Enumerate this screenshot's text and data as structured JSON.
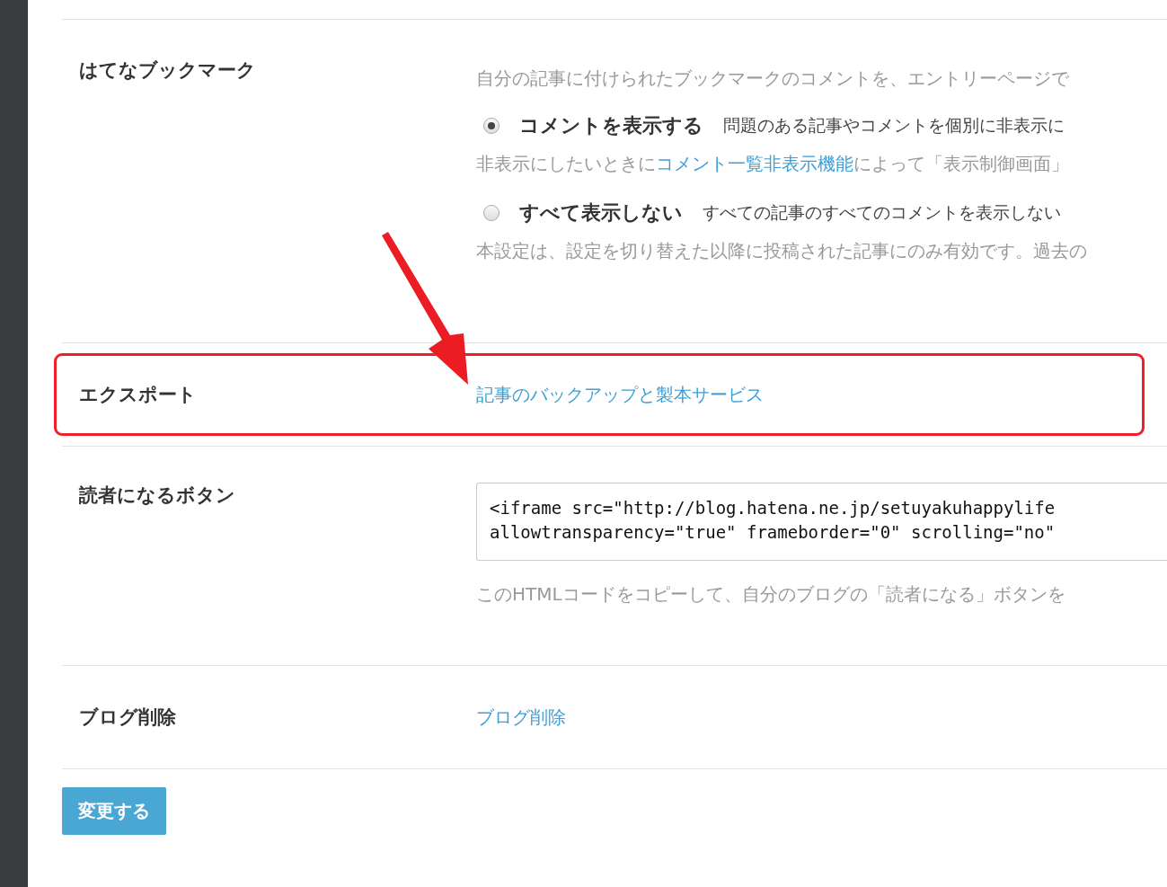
{
  "sections": [
    {
      "kind": "radio_group",
      "label": "はてなブックマーク",
      "description": "自分の記事に付けられたブックマークのコメントを、エントリーページで",
      "options": [
        {
          "label": "コメントを表示する",
          "description": "問題のある記事やコメントを個別に非表示に",
          "selected": true,
          "note_before": "非表示にしたいときに",
          "note_link": "コメント一覧非表示機能",
          "note_after": "によって「表示制御画面」"
        },
        {
          "label": "すべて表示しない",
          "description": "すべての記事のすべてのコメントを表示しない",
          "selected": false
        }
      ],
      "footnote": "本設定は、設定を切り替えた以降に投稿された記事にのみ有効です。過去の"
    },
    {
      "kind": "link",
      "label": "エクスポート",
      "link": "記事のバックアップと製本サービス"
    },
    {
      "kind": "code",
      "label": "読者になるボタン",
      "code": "<iframe src=\"http://blog.hatena.ne.jp/setuyakuhappylife\nallowtransparency=\"true\" frameborder=\"0\" scrolling=\"no\"",
      "help": "このHTMLコードをコピーして、自分のブログの「読者になる」ボタンを"
    },
    {
      "kind": "link",
      "label": "ブログ削除",
      "link": "ブログ削除"
    }
  ],
  "submit": "変更する"
}
